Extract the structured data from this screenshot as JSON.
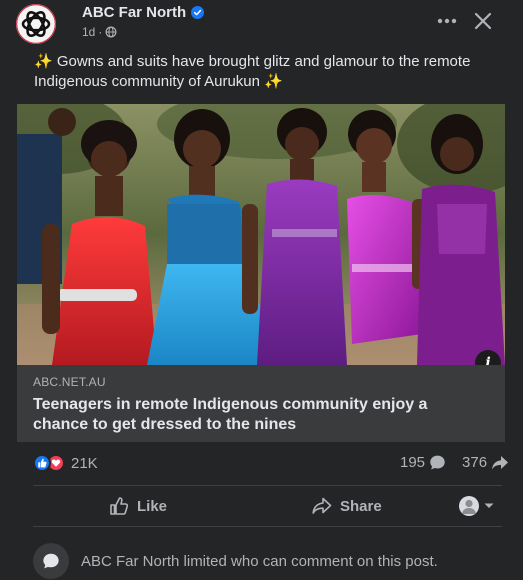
{
  "post": {
    "page_name": "ABC Far North",
    "timestamp": "1d",
    "text": "✨ Gowns and suits have brought glitz and glamour to the remote Indigenous community of Aurukun ✨",
    "link": {
      "domain": "ABC.NET.AU",
      "title": "Teenagers in remote Indigenous community enjoy a chance to get dressed to the nines"
    },
    "stats": {
      "reactions_count": "21K",
      "comments_count": "195",
      "shares_count": "376"
    },
    "actions": {
      "like": "Like",
      "share": "Share"
    },
    "comment_notice": "ABC Far North limited who can comment on this post."
  },
  "icons": {
    "verified": "verified-badge-icon",
    "globe": "globe-icon",
    "more": "more-options-icon",
    "close": "close-icon",
    "info": "info-icon",
    "like_reaction": "like-reaction-icon",
    "love_reaction": "love-reaction-icon",
    "comment": "comment-icon",
    "share": "share-arrow-icon"
  },
  "colors": {
    "background": "#242526",
    "accent": "#1877f2",
    "love": "#f33e58",
    "abc_logo": "#111111",
    "red_dress": "#e0272f",
    "blue_dress": "#28a8e6",
    "purple_dress": "#7a2aa0",
    "magenta_dress": "#c22ac8"
  }
}
